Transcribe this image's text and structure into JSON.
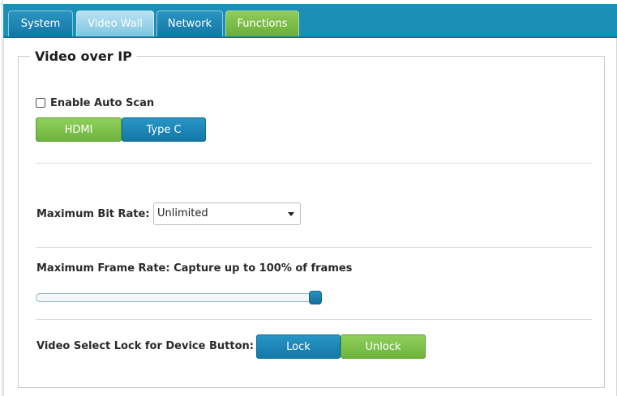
{
  "tabs": [
    {
      "label": "System"
    },
    {
      "label": "Video Wall"
    },
    {
      "label": "Network"
    },
    {
      "label": "Functions"
    }
  ],
  "active_tab": "Video Wall",
  "section": {
    "title": "Video over IP"
  },
  "auto_scan": {
    "label": "Enable Auto Scan",
    "checked": false
  },
  "source_buttons": {
    "hdmi": "HDMI",
    "typec": "Type C"
  },
  "bitrate": {
    "label": "Maximum Bit Rate:",
    "value": "Unlimited"
  },
  "framerate": {
    "label": "Maximum Frame Rate: Capture up to 100% of frames",
    "percent": 100
  },
  "lock": {
    "label": "Video Select Lock for Device Button:",
    "lock_label": "Lock",
    "unlock_label": "Unlock"
  },
  "colors": {
    "accent_blue": "#1b8fb5",
    "accent_green": "#7ab848"
  }
}
